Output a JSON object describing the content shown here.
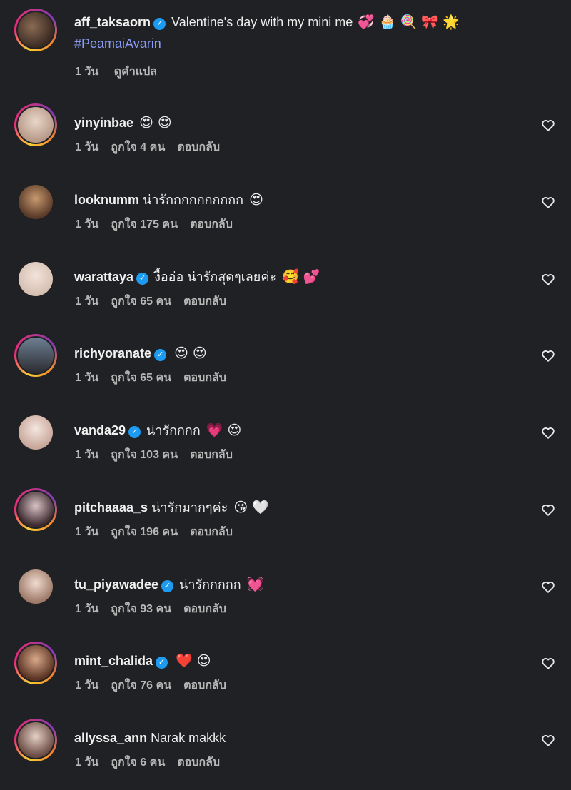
{
  "caption": {
    "username": "aff_taksaorn",
    "text": "Valentine's day with my mini me",
    "emojis": "💞 🧁 🍭 🎀 🌟",
    "hashtag": "#PeamaiAvarin",
    "time": "1 วัน",
    "translate": "ดูคำแปล"
  },
  "labels": {
    "reply": "ตอบกลับ"
  },
  "colors": {
    "background": "#202124",
    "verified": "#1d9bf0",
    "hashtag": "#8a9cf5",
    "story_ring": "#ee2a7b"
  },
  "comments": [
    {
      "username": "yinyinbae",
      "verified": false,
      "text": "",
      "emojis": "😍 😍",
      "time": "1 วัน",
      "likes": "ถูกใจ 4 คน"
    },
    {
      "username": "looknumm",
      "verified": false,
      "text": "น่ารักกกกกกกกกก",
      "emojis": "😍",
      "time": "1 วัน",
      "likes": "ถูกใจ 175 คน"
    },
    {
      "username": "warattaya",
      "verified": true,
      "text": "งื้ออ่อ น่ารักสุดๆเลยค่ะ",
      "emojis": "🥰 💕",
      "time": "1 วัน",
      "likes": "ถูกใจ 65 คน"
    },
    {
      "username": "richyoranate",
      "verified": true,
      "text": "",
      "emojis": "😍 😍",
      "time": "1 วัน",
      "likes": "ถูกใจ 65 คน"
    },
    {
      "username": "vanda29",
      "verified": true,
      "text": "น่ารักกกก",
      "emojis": "💗 😍",
      "time": "1 วัน",
      "likes": "ถูกใจ 103 คน"
    },
    {
      "username": "pitchaaaa_s",
      "verified": false,
      "text": "น่ารักมากๆค่ะ",
      "emojis": "😘 🤍",
      "time": "1 วัน",
      "likes": "ถูกใจ 196 คน"
    },
    {
      "username": "tu_piyawadee",
      "verified": true,
      "text": "น่ารักกกกก",
      "emojis": "💓",
      "time": "1 วัน",
      "likes": "ถูกใจ 93 คน"
    },
    {
      "username": "mint_chalida",
      "verified": true,
      "text": "",
      "emojis": "❤️ 😍",
      "time": "1 วัน",
      "likes": "ถูกใจ 76 คน"
    },
    {
      "username": "allyssa_ann",
      "verified": false,
      "text": "Narak makkk",
      "emojis": "",
      "time": "1 วัน",
      "likes": "ถูกใจ 6 คน"
    }
  ]
}
